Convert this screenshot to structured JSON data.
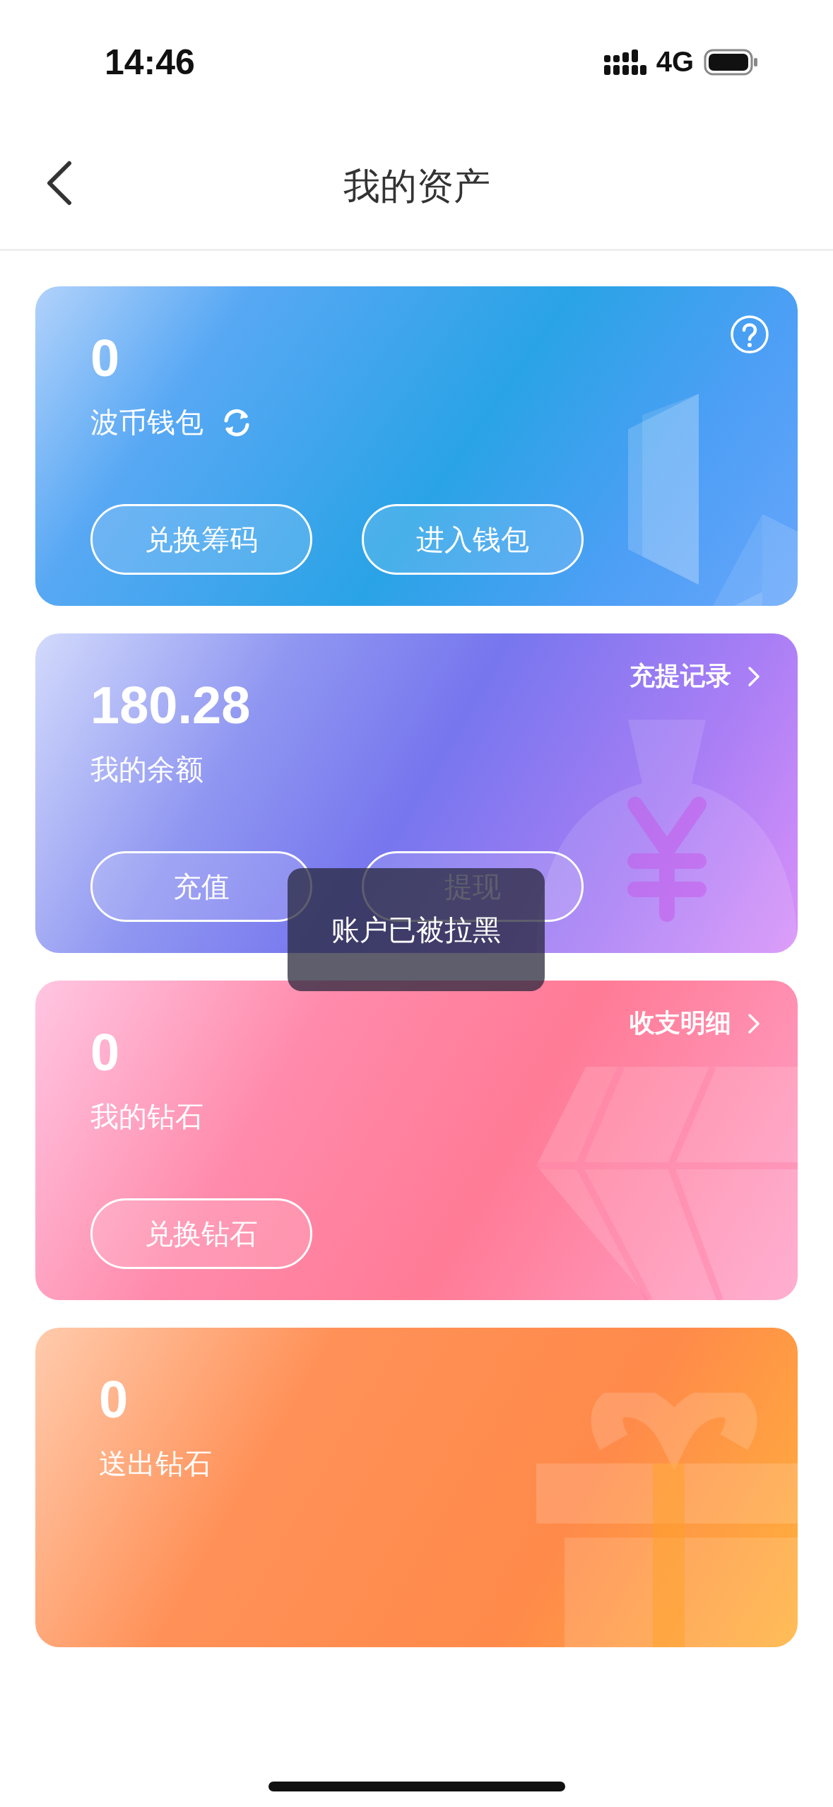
{
  "status_bar": {
    "time": "14:46",
    "network": "4G"
  },
  "nav": {
    "title": "我的资产"
  },
  "cards": [
    {
      "kind": "wallet",
      "amount": "0",
      "label": "波币钱包",
      "refresh": true,
      "help": true,
      "buttons": [
        "兑换筹码",
        "进入钱包"
      ]
    },
    {
      "kind": "balance",
      "amount": "180.28",
      "label": "我的余额",
      "link": "充提记录",
      "buttons": [
        "充值",
        "提现"
      ]
    },
    {
      "kind": "diamond",
      "amount": "0",
      "label": "我的钻石",
      "link": "收支明细",
      "buttons": [
        "兑换钻石"
      ]
    },
    {
      "kind": "gift",
      "amount": "0",
      "label": "送出钻石"
    }
  ],
  "toast": "账户已被拉黑"
}
